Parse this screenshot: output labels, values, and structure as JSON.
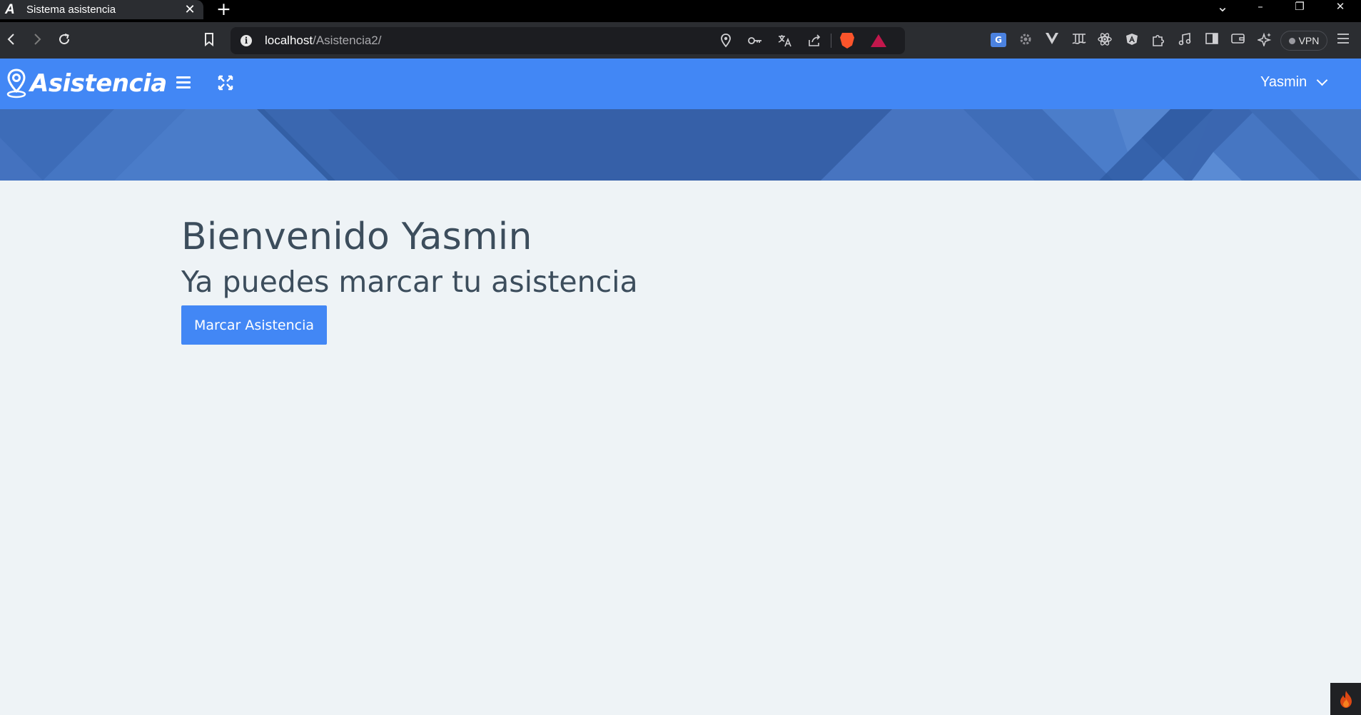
{
  "browser": {
    "tab": {
      "favicon": "A",
      "title": "Sistema asistencia",
      "close": "✕"
    },
    "new_tab": "+",
    "window_controls": {
      "tab_search": "⌄",
      "minimize": "–",
      "restore": "❐",
      "close": "✕"
    },
    "address_bar": {
      "host": "localhost",
      "path": "/Asistencia2/"
    },
    "vpn_label": "VPN",
    "translate_badge": "G"
  },
  "app": {
    "brand": "Asistencia",
    "user_name": "Yasmin",
    "welcome_heading": "Bienvenido Yasmin",
    "subtitle": "Ya puedes marcar tu asistencia",
    "mark_button_label": "Marcar Asistencia",
    "colors": {
      "primary": "#4287f5",
      "banner": "#3d6fc1",
      "background": "#eef3f6",
      "text": "#3c4d5c"
    }
  }
}
